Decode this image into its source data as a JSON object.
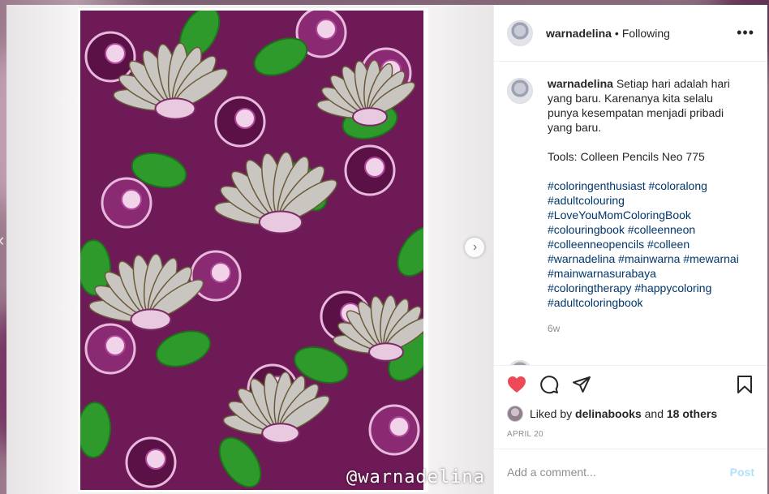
{
  "post": {
    "username": "warnadelina",
    "follow_status": "Following",
    "separator": "•",
    "more_label": "•••",
    "caption": {
      "lines": [
        "Setiap hari adalah hari yang baru. Karenanya kita selalu punya kesempatan menjadi pribadi yang baru."
      ],
      "tools": "Tools: Colleen Pencils Neo 775",
      "hashtags": [
        "#coloringenthusiast #coloralong",
        "#adultcolouring",
        "#LoveYouMomColoringBook",
        "#colouringbook #colleenneon",
        "#colleenneopencils #colleen",
        "#warnadelina #mainwarna #mewarnai",
        "#mainwarnasurabaya",
        "#coloringtherapy #happycoloring",
        "#adultcoloringbook"
      ],
      "age": "6w"
    },
    "likes": {
      "prefix": "Liked by",
      "user": "delinabooks",
      "and": "and",
      "others": "18 others"
    },
    "date": "APRIL 20",
    "comment_input": {
      "placeholder": "Add a comment..."
    },
    "post_label": "Post",
    "image_watermark": "@warnadelina"
  },
  "icons": {
    "like": "heart-filled-icon",
    "comment": "comment-bubble-icon",
    "share": "paper-plane-icon",
    "save": "bookmark-icon",
    "next": "chevron-right-icon"
  },
  "colors": {
    "like_red": "#ed4956",
    "link_blue": "#00376b",
    "post_disabled": "#b2dffc",
    "artwork_purple": "#6e1a57",
    "artwork_green": "#2f9a2c",
    "artwork_grey": "#c9c6c2"
  }
}
